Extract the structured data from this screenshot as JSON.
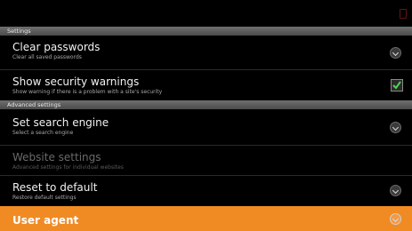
{
  "sections": {
    "settings": "Settings",
    "advanced": "Advanced settings"
  },
  "rows": [
    {
      "title": "Clear passwords",
      "summary": "Clear all saved passwords"
    },
    {
      "title": "Show security warnings",
      "summary": "Show warning if there is a problem with a site's security",
      "checked": true
    },
    {
      "title": "Set search engine",
      "summary": "Select a search engine"
    },
    {
      "title": "Website settings",
      "summary": "Advanced settings for individual websites",
      "disabled": true
    },
    {
      "title": "Reset to default",
      "summary": "Restore default settings"
    },
    {
      "title": "User agent"
    }
  ],
  "colors": {
    "highlight": "#f08b24",
    "check": "#4fd64f"
  }
}
